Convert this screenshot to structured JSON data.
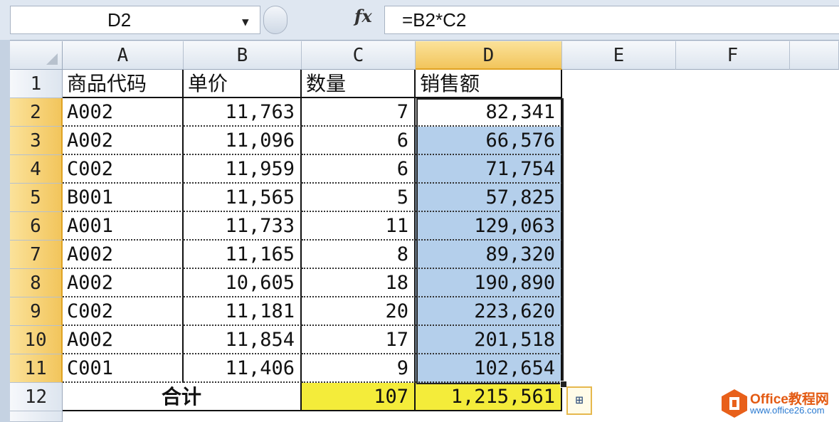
{
  "formula_bar": {
    "name_box": "D2",
    "fx_label": "fx",
    "formula": "=B2*C2"
  },
  "columns": [
    "A",
    "B",
    "C",
    "D",
    "E",
    "F"
  ],
  "active_column": "D",
  "rows": [
    "1",
    "2",
    "3",
    "4",
    "5",
    "6",
    "7",
    "8",
    "9",
    "10",
    "11",
    "12"
  ],
  "headers": {
    "a": "商品代码",
    "b": "单价",
    "c": "数量",
    "d": "销售额"
  },
  "data": [
    {
      "code": "A002",
      "price": "11,763",
      "qty": "7",
      "sales": "82,341"
    },
    {
      "code": "A002",
      "price": "11,096",
      "qty": "6",
      "sales": "66,576"
    },
    {
      "code": "C002",
      "price": "11,959",
      "qty": "6",
      "sales": "71,754"
    },
    {
      "code": "B001",
      "price": "11,565",
      "qty": "5",
      "sales": "57,825"
    },
    {
      "code": "A001",
      "price": "11,733",
      "qty": "11",
      "sales": "129,063"
    },
    {
      "code": "A002",
      "price": "11,165",
      "qty": "8",
      "sales": "89,320"
    },
    {
      "code": "A002",
      "price": "10,605",
      "qty": "18",
      "sales": "190,890"
    },
    {
      "code": "C002",
      "price": "11,181",
      "qty": "20",
      "sales": "223,620"
    },
    {
      "code": "A002",
      "price": "11,854",
      "qty": "17",
      "sales": "201,518"
    },
    {
      "code": "C001",
      "price": "11,406",
      "qty": "9",
      "sales": "102,654"
    }
  ],
  "total": {
    "label": "合计",
    "qty": "107",
    "sales": "1,215,561"
  },
  "colors": {
    "selection": "#b4cfeb",
    "total_fill": "#f4ec3a",
    "active_header": "#f2c55c"
  },
  "watermark": {
    "brand": "Office教程网",
    "url": "www.office26.com"
  }
}
